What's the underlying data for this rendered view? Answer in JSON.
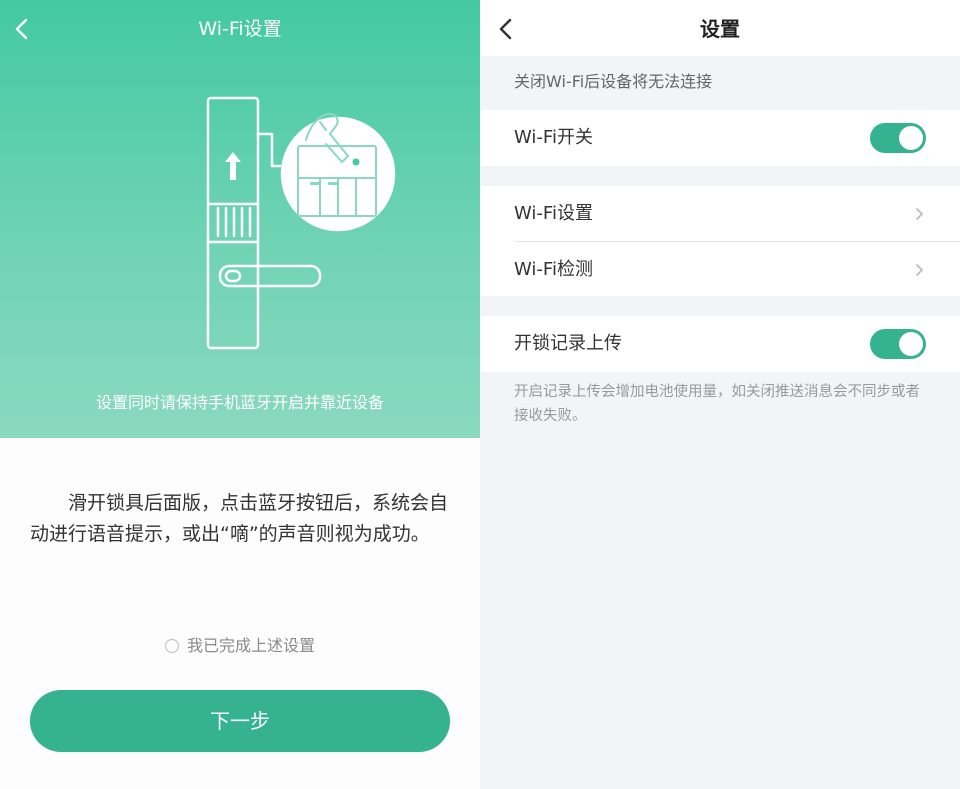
{
  "wifi_setup_screen": {
    "title": "Wi-Fi设置",
    "illustration_caption": "设置同时请保持手机蓝牙开启并靠近设备",
    "instruction": "滑开锁具后面版，点击蓝牙按钮后，系统会自动进行语音提示，或出“嘀”的声音则视为成功。",
    "confirm_label": "我已完成上述设置",
    "confirm_checked": false,
    "next_button_label": "下一步",
    "colors": {
      "hero_top": "#43c9a3",
      "hero_bottom": "#8ad9bf",
      "button": "#35b290"
    }
  },
  "settings_screen": {
    "title": "设置",
    "wifi_note": "关闭Wi-Fi后设备将无法连接",
    "wifi_switch": {
      "label": "Wi-Fi开关",
      "on": true
    },
    "wifi_settings_label": "Wi-Fi设置",
    "wifi_detect_label": "Wi-Fi检测",
    "unlock_record_upload": {
      "label": "开锁记录上传",
      "on": true
    },
    "upload_description": "开启记录上传会增加电池使用量，如关闭推送消息会不同步或者接收失败。",
    "colors": {
      "toggle_on": "#35b290",
      "background": "#f3f4f6"
    }
  }
}
